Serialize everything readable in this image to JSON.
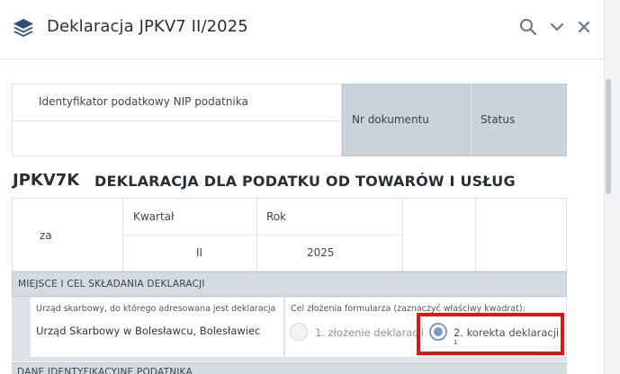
{
  "header": {
    "title": "Deklaracja JPKV7 II/2025",
    "logo_icon": "layers-icon",
    "actions": [
      "search-icon",
      "chevron-down-icon",
      "close-icon"
    ],
    "accent": "#2d4f80"
  },
  "top_table": {
    "nip_label": "Identyfikator podatkowy NIP podatnika",
    "nr_dokumentu": "Nr dokumentu",
    "status": "Status"
  },
  "form": {
    "code": "JPKV7K",
    "title": "DEKLARACJA DLA PODATKU OD TOWARÓW I USŁUG"
  },
  "period": {
    "za": "za",
    "kwartal_label": "Kwartał",
    "kwartal_value": "II",
    "rok_label": "Rok",
    "rok_value": "2025"
  },
  "section1": {
    "title": "MIEJSCE I CEL SKŁADANIA DEKLARACJI",
    "office_label": "Urząd skarbowy, do którego adresowana jest deklaracja",
    "office_value": "Urząd Skarbowy w Bolesławcu, Bolesławiec",
    "goal_label": "Cel złożenia formularza (zaznaczyć właściwy kwadrat):",
    "option1": "1. złożenie deklaracji",
    "option2": "2. korekta deklaracji",
    "option2_sup": "1",
    "selected": 2
  },
  "section2": {
    "title": "DANE IDENTYFIKACYJNE PODATNIKA"
  },
  "colors": {
    "highlight": "#e01414",
    "header_cell": "#cbd3da",
    "radio_selected": "#7d99c5"
  }
}
